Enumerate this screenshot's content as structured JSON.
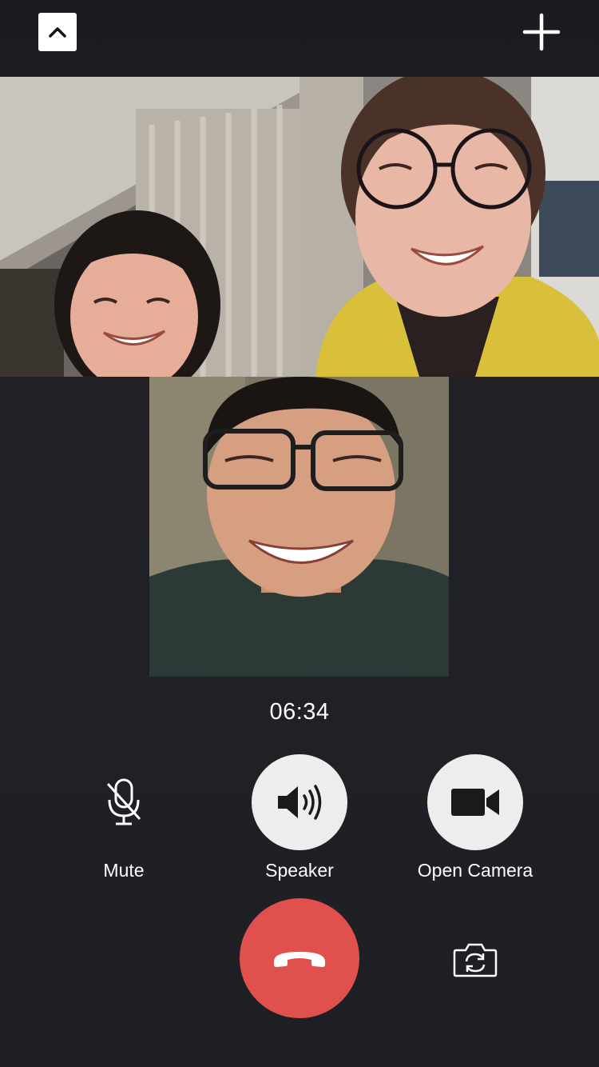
{
  "top_bar": {
    "minimize_icon": "chevron-up-icon",
    "add_icon": "plus-icon"
  },
  "participants": [
    {
      "tile": "participant-video-1"
    },
    {
      "tile": "participant-video-2"
    },
    {
      "tile": "participant-video-3"
    }
  ],
  "call": {
    "timer": "06:34"
  },
  "controls": {
    "mute_label": "Mute",
    "speaker_label": "Speaker",
    "camera_label": "Open Camera",
    "mute_icon": "microphone-muted-icon",
    "speaker_icon": "speaker-icon",
    "camera_icon": "video-camera-icon",
    "hangup_icon": "phone-hangup-icon",
    "flip_icon": "camera-flip-icon"
  },
  "colors": {
    "background": "#1f1f23",
    "hangup": "#e0504d",
    "control_circle": "#ededed",
    "text": "#ffffff"
  }
}
